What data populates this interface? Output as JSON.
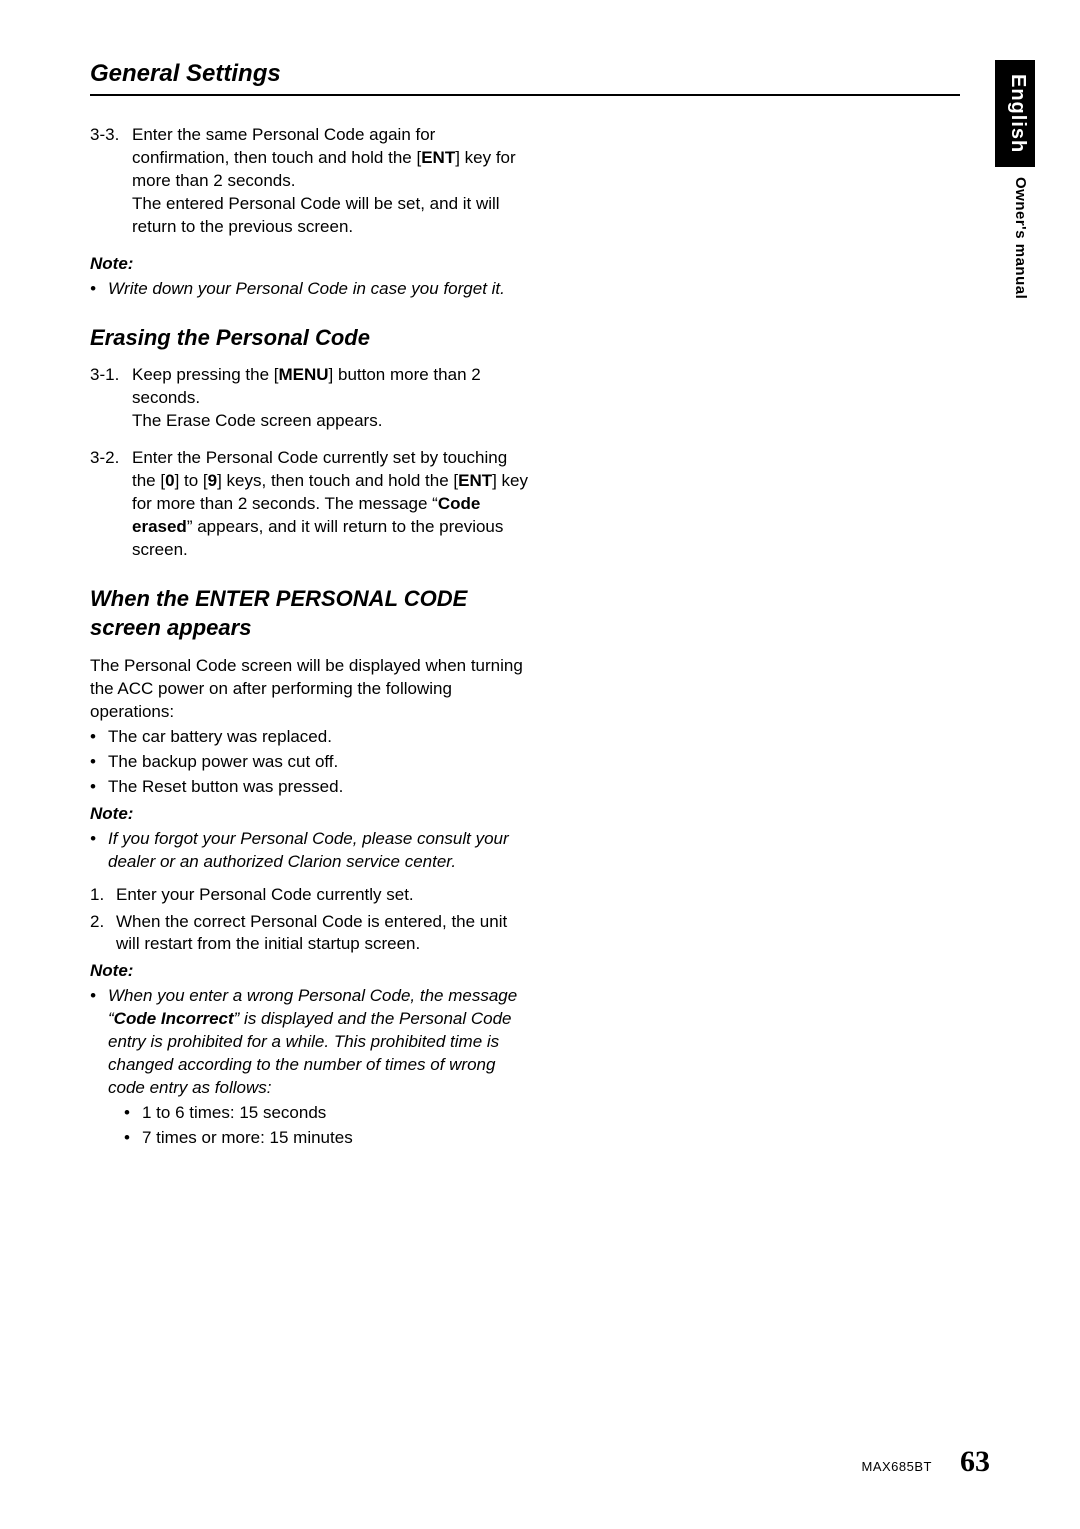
{
  "side": {
    "lang": "English",
    "sub": "Owner's manual"
  },
  "header": "General Settings",
  "sec1": {
    "step3_3_num": "3-3.",
    "step3_3_a": "Enter the same Personal Code again for confirmation, then touch and hold the [",
    "step3_3_b": "ENT",
    "step3_3_c": "] key for more than 2 seconds.",
    "step3_3_d": "The entered Personal Code will be set, and it will return to the previous screen.",
    "note_label": "Note:",
    "note_bullet": "Write down your Personal Code in case you forget it."
  },
  "sec2": {
    "title": "Erasing the Personal Code",
    "s1_num": "3-1.",
    "s1_a": "Keep pressing the [",
    "s1_b": "MENU",
    "s1_c": "] button more than 2 seconds.",
    "s1_d": "The Erase Code screen appears.",
    "s2_num": "3-2.",
    "s2_a": "Enter the Personal Code currently set by touching the [",
    "s2_b": "0",
    "s2_c": "] to [",
    "s2_d": "9",
    "s2_e": "] keys, then touch and hold the [",
    "s2_f": "ENT",
    "s2_g": "] key for more than 2 seconds. The message “",
    "s2_h": "Code erased",
    "s2_i": "” appears, and it will return to the previous screen."
  },
  "sec3": {
    "title": "When the ENTER PERSONAL CODE screen appears",
    "intro": "The Personal Code screen will be displayed when turning the ACC power on after performing the following operations:",
    "b1": "The car battery was replaced.",
    "b2": "The backup power was cut off.",
    "b3": "The Reset button was pressed.",
    "note1_label": "Note:",
    "note1_body": "If you forgot your Personal Code, please consult your dealer or an authorized Clarion service center.",
    "ol1_num": "1.",
    "ol1_body": "Enter your Personal Code currently set.",
    "ol2_num": "2.",
    "ol2_body": "When the correct Personal Code is entered, the unit will restart from the initial startup screen.",
    "note2_label": "Note:",
    "note2_a": "When you enter a wrong Personal Code, the message “",
    "note2_b": "Code Incorrect",
    "note2_c": "” is displayed and the Personal Code entry is prohibited for a while. This prohibited time is changed according to the number of times of wrong code entry as follows:",
    "sb1": "1 to 6 times: 15 seconds",
    "sb2": "7 times or more: 15 minutes"
  },
  "footer": {
    "model": "MAX685BT",
    "page": "63"
  }
}
